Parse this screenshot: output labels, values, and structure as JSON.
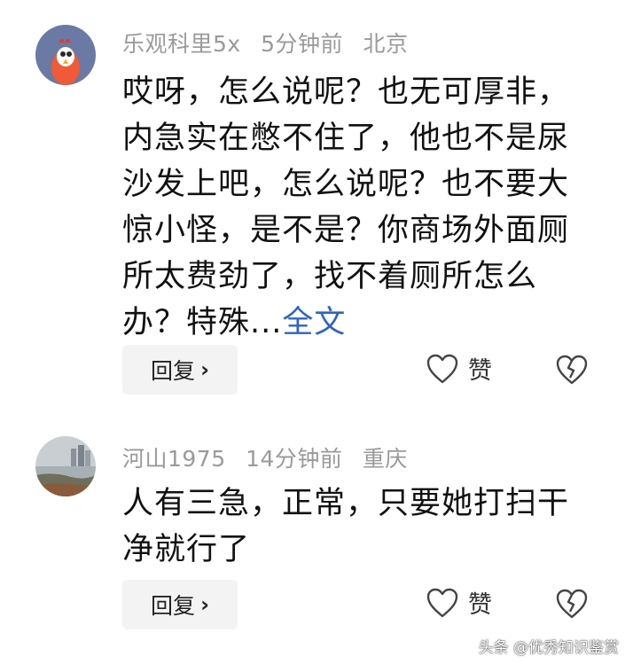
{
  "comments": [
    {
      "username": "乐观科里5x",
      "time": "5分钟前",
      "location": "北京",
      "text_lines": [
        "哎呀，怎么说呢？也无可厚非，",
        "内急实在憋不住了，他也不是尿",
        "沙发上吧，怎么说呢？也不要大",
        "惊小怪，是不是？你商场外面厕",
        "所太费劲了，找不着厕所怎么",
        "办？特殊..."
      ],
      "more_label": "全文",
      "reply_label": "回复",
      "like_label": "赞"
    },
    {
      "username": "河山1975",
      "time": "14分钟前",
      "location": "重庆",
      "text_lines": [
        "人有三急，正常，只要她打扫干",
        "净就行了"
      ],
      "reply_label": "回复",
      "like_label": "赞"
    }
  ],
  "watermark": "头条 @优秀知识鉴赏",
  "icons": {
    "like": "heart-outline-icon",
    "dislike": "broken-heart-icon",
    "reply_chevron": "chevron-right-icon"
  },
  "colors": {
    "link": "#2f64c4",
    "meta": "#9a9a9a",
    "button_bg": "#f3f3f3"
  }
}
